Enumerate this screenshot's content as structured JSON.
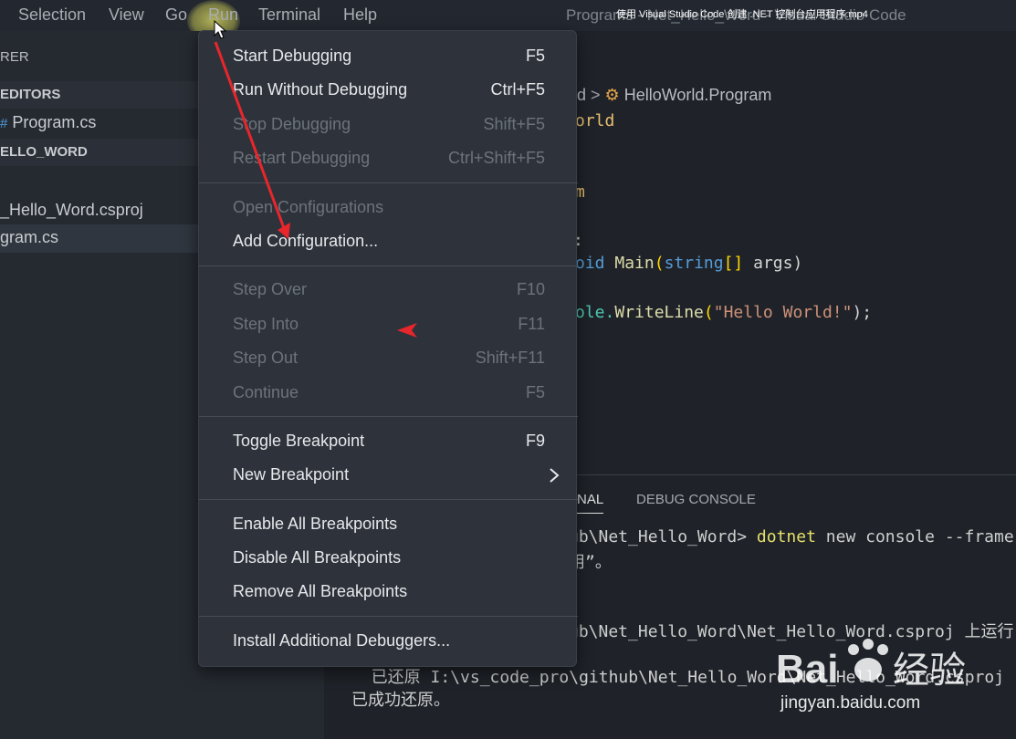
{
  "menubar": {
    "items": [
      "Selection",
      "View",
      "Go",
      "Run",
      "Terminal",
      "Help"
    ],
    "window_title": "Programs - Net_Hello_Word - Visual Studio Code",
    "video_title": "使用 Visual Studio Code 创建 .NET 控制台应用程序.mp4"
  },
  "sidebar": {
    "title": "RER",
    "open_editors": "EDITORS",
    "open_file": "Program.cs",
    "folder": "ELLO_WORD",
    "files": [
      "_Hello_Word.csproj",
      "gram.cs"
    ]
  },
  "editor": {
    "breadcrumb_prefix": "d",
    "breadcrumb_class": "HelloWorld.Program",
    "lines": {
      "l1": "orld",
      "l2": "m",
      "l3": ":",
      "l4_a": "oid ",
      "l4_fn": "Main",
      "l4_p": "(",
      "l4_type": "string",
      "l4_br": "[]",
      "l4_rest": " args)",
      "l5_a": "ole.",
      "l5_fn": "WriteLine",
      "l5_p": "(",
      "l5_str": "\"Hello World!\"",
      "l5_end": ");"
    }
  },
  "panel": {
    "tabs": [
      "NAL",
      "DEBUG CONSOLE"
    ],
    "terminal": {
      "t1_a": "ub\\Net_Hello_Word> ",
      "t1_cmd": "dotnet",
      "t1_rest": " new console --frame",
      "t2": "用”。",
      "t3": "ub\\Net_Hello_Word\\Net_Hello_Word.csproj 上运行",
      "t4": ".",
      "t5": "  已还原 I:\\vs_code_pro\\github\\Net_Hello_Word\\Net_Hello_Word.csproj",
      "t6": "已成功还原。"
    }
  },
  "run_menu": {
    "groups": [
      [
        {
          "label": "Start Debugging",
          "key": "F5",
          "enabled": true
        },
        {
          "label": "Run Without Debugging",
          "key": "Ctrl+F5",
          "enabled": true
        },
        {
          "label": "Stop Debugging",
          "key": "Shift+F5",
          "enabled": false
        },
        {
          "label": "Restart Debugging",
          "key": "Ctrl+Shift+F5",
          "enabled": false
        }
      ],
      [
        {
          "label": "Open Configurations",
          "key": "",
          "enabled": false
        },
        {
          "label": "Add Configuration...",
          "key": "",
          "enabled": true
        }
      ],
      [
        {
          "label": "Step Over",
          "key": "F10",
          "enabled": false
        },
        {
          "label": "Step Into",
          "key": "F11",
          "enabled": false
        },
        {
          "label": "Step Out",
          "key": "Shift+F11",
          "enabled": false
        },
        {
          "label": "Continue",
          "key": "F5",
          "enabled": false
        }
      ],
      [
        {
          "label": "Toggle Breakpoint",
          "key": "F9",
          "enabled": true
        },
        {
          "label": "New Breakpoint",
          "key": "",
          "enabled": true,
          "submenu": true
        }
      ],
      [
        {
          "label": "Enable All Breakpoints",
          "key": "",
          "enabled": true
        },
        {
          "label": "Disable All Breakpoints",
          "key": "",
          "enabled": true
        },
        {
          "label": "Remove All Breakpoints",
          "key": "",
          "enabled": true
        }
      ],
      [
        {
          "label": "Install Additional Debuggers...",
          "key": "",
          "enabled": true
        }
      ]
    ]
  },
  "watermark": {
    "logo": "Bai 经验",
    "url": "jingyan.baidu.com"
  },
  "colors": {
    "menu_bg": "#2e333b",
    "annotation": "#e8262b"
  }
}
